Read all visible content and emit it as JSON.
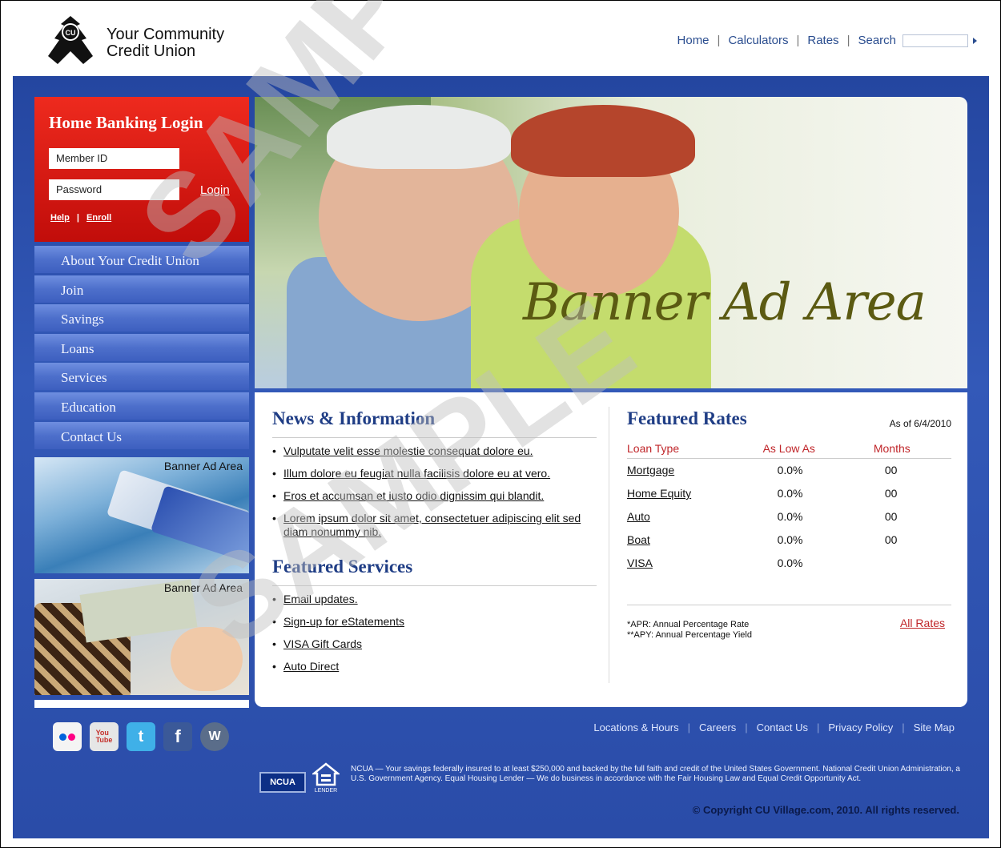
{
  "brand": {
    "line1": "Your Community",
    "line2": "Credit Union",
    "logo_icon": "cu-logo-icon"
  },
  "topnav": {
    "items": [
      "Home",
      "Calculators",
      "Rates",
      "Search"
    ]
  },
  "login": {
    "title": "Home Banking Login",
    "member_placeholder": "Member ID",
    "password_placeholder": "Password",
    "button": "Login",
    "help": "Help",
    "sep": "|",
    "enroll": "Enroll"
  },
  "sidenav": {
    "items": [
      "About Your Credit Union",
      "Join",
      "Savings",
      "Loans",
      "Services",
      "Education",
      "Contact Us"
    ]
  },
  "side_ads": [
    "Banner Ad Area",
    "Banner Ad Area"
  ],
  "banner": {
    "text": "Banner Ad Area"
  },
  "news": {
    "title": "News & Information",
    "items": [
      "Vulputate velit esse molestie consequat dolore eu.",
      "Illum dolore eu feugiat nulla facilisis dolore eu at vero.",
      "Eros et accumsan et iusto odio dignissim qui blandit.",
      "Lorem ipsum dolor sit amet, consectetuer adipiscing elit sed diam nonummy nib."
    ]
  },
  "services": {
    "title": "Featured Services",
    "items": [
      "Email updates.",
      "Sign-up for eStatements",
      "VISA Gift Cards",
      "Auto Direct"
    ]
  },
  "rates": {
    "title": "Featured Rates",
    "as_of": "As of 6/4/2010",
    "headers": [
      "Loan Type",
      "As Low As",
      "Months"
    ],
    "rows": [
      {
        "type": "Mortgage",
        "rate": "0.0%",
        "months": "00"
      },
      {
        "type": "Home Equity",
        "rate": "0.0%",
        "months": "00"
      },
      {
        "type": "Auto",
        "rate": "0.0%",
        "months": "00"
      },
      {
        "type": "Boat",
        "rate": "0.0%",
        "months": "00"
      },
      {
        "type": "VISA",
        "rate": "0.0%",
        "months": ""
      }
    ],
    "note1": "*APR: Annual Percentage Rate",
    "note2": "**APY: Annual Percentage Yield",
    "all_rates": "All Rates"
  },
  "social": [
    "flickr-icon",
    "youtube-icon",
    "twitter-icon",
    "facebook-icon",
    "wordpress-icon"
  ],
  "footer": {
    "links": [
      "Locations & Hours",
      "Careers",
      "Contact Us",
      "Privacy Policy",
      "Site Map"
    ],
    "ncua": "NCUA",
    "legal": "NCUA — Your savings federally insured to at least $250,000 and backed by the full faith and credit of the United States Government. National Credit Union Administration, a U.S. Government Agency.  Equal Housing Lender — We do business in accordance with the Fair Housing Law and Equal Credit Opportunity Act.",
    "copyright": "© Copyright CU Village.com, 2010. All rights reserved.",
    "ehl_label": "LENDER"
  },
  "watermark": "SAMPLE"
}
